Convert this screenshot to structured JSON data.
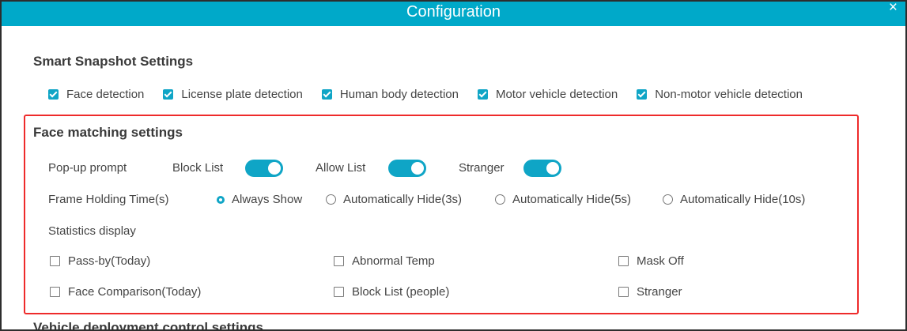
{
  "window": {
    "title": "Configuration",
    "close_glyph": "×"
  },
  "smart_snapshot": {
    "title": "Smart Snapshot Settings",
    "options": [
      {
        "label": "Face detection",
        "checked": true
      },
      {
        "label": "License plate detection",
        "checked": true
      },
      {
        "label": "Human body detection",
        "checked": true
      },
      {
        "label": "Motor vehicle detection",
        "checked": true
      },
      {
        "label": "Non-motor vehicle detection",
        "checked": true
      }
    ]
  },
  "face_matching": {
    "title": "Face matching settings",
    "popup": {
      "label": "Pop-up prompt",
      "toggles": [
        {
          "label": "Block List",
          "on": true
        },
        {
          "label": "Allow List",
          "on": true
        },
        {
          "label": "Stranger",
          "on": true
        }
      ]
    },
    "frame_holding": {
      "label": "Frame Holding Time(s)",
      "options": [
        {
          "label": "Always Show",
          "selected": true
        },
        {
          "label": "Automatically Hide(3s)",
          "selected": false
        },
        {
          "label": "Automatically Hide(5s)",
          "selected": false
        },
        {
          "label": "Automatically Hide(10s)",
          "selected": false
        }
      ]
    },
    "statistics": {
      "label": "Statistics display",
      "items": [
        {
          "label": "Pass-by(Today)",
          "checked": false
        },
        {
          "label": "Abnormal Temp",
          "checked": false
        },
        {
          "label": "Mask Off",
          "checked": false
        },
        {
          "label": "Face Comparison(Today)",
          "checked": false
        },
        {
          "label": "Block List (people)",
          "checked": false
        },
        {
          "label": "Stranger",
          "checked": false
        }
      ]
    }
  },
  "vehicle": {
    "title": "Vehicle deployment control settings"
  },
  "colors": {
    "titlebar": "#00a9c9",
    "accent": "#0fa5c6",
    "highlight_border": "#ee2b2b"
  }
}
